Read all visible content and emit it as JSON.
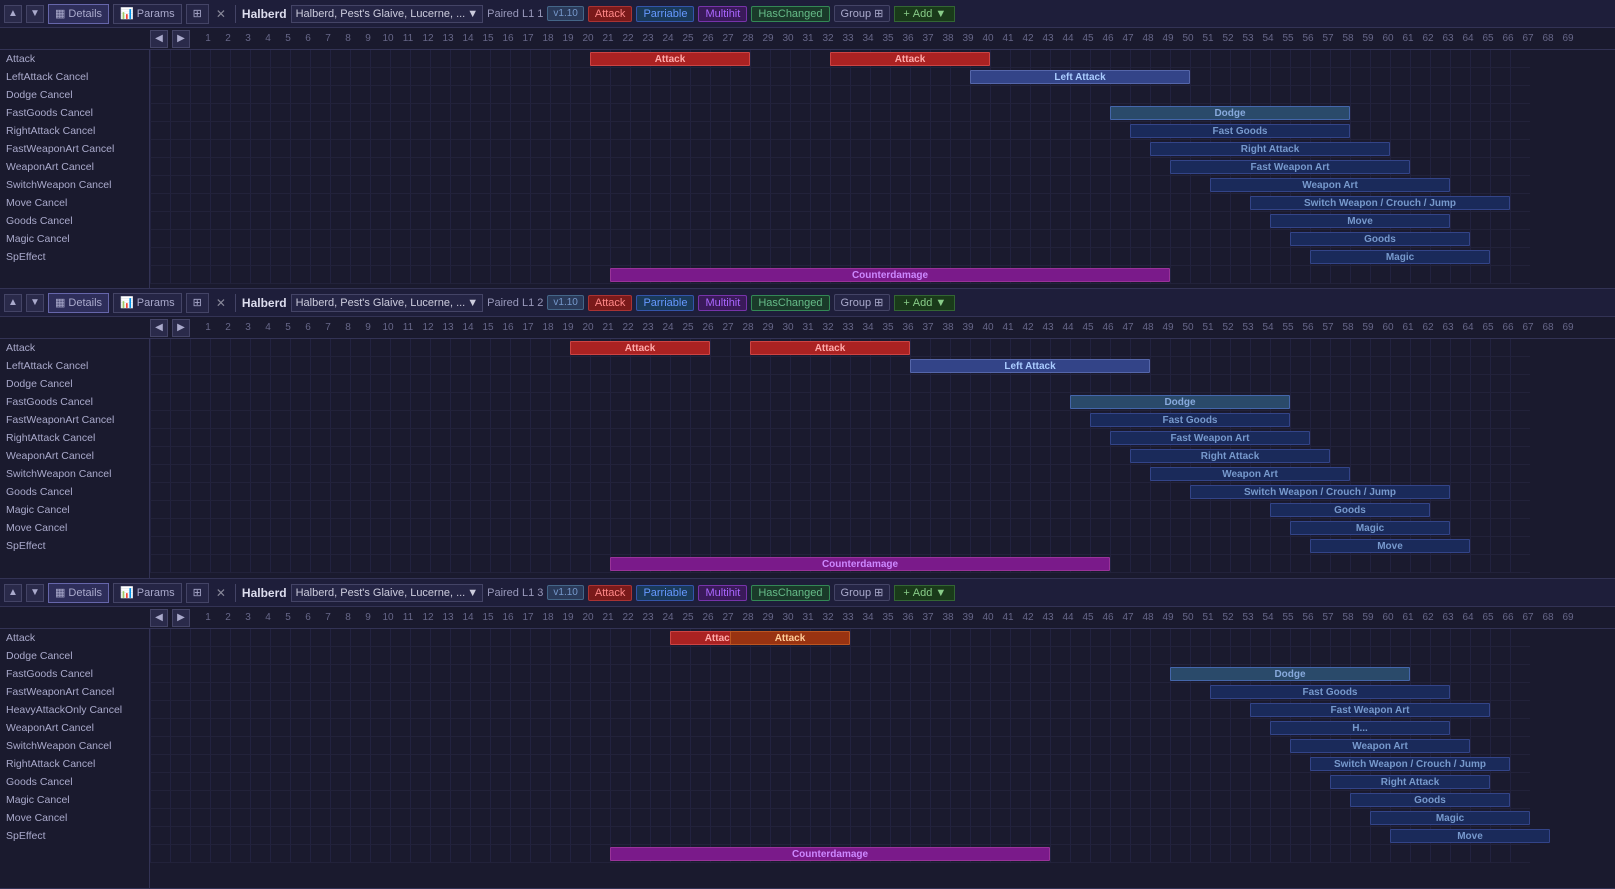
{
  "panels": [
    {
      "id": "panel1",
      "header": {
        "weapon": "Halberd",
        "dropdown": "Halberd, Pest's Glaive, Lucerne, ...",
        "combo": "Paired L1 1",
        "version": "v1.10",
        "badges": [
          "Attack",
          "Parriable",
          "Multihit",
          "HasChanged"
        ],
        "group": "Group",
        "add": "+ Add"
      },
      "rows": [
        {
          "label": "Attack",
          "bars": [
            {
              "start": 23,
              "end": 30,
              "type": "attack-red",
              "text": "Attack"
            },
            {
              "start": 35,
              "end": 42,
              "type": "attack-red",
              "text": "Attack"
            }
          ]
        },
        {
          "label": "LeftAttack Cancel",
          "bars": [
            {
              "start": 42,
              "end": 52,
              "type": "leftattack",
              "text": "Left Attack"
            }
          ]
        },
        {
          "label": "Dodge Cancel",
          "bars": []
        },
        {
          "label": "FastGoods Cancel",
          "bars": [
            {
              "start": 49,
              "end": 60,
              "type": "dodge",
              "text": "Dodge"
            }
          ]
        },
        {
          "label": "RightAttack Cancel",
          "bars": [
            {
              "start": 50,
              "end": 60,
              "type": "blue-dark",
              "text": "Fast Goods"
            }
          ]
        },
        {
          "label": "FastWeaponArt Cancel",
          "bars": [
            {
              "start": 51,
              "end": 62,
              "type": "blue-dark",
              "text": "Right Attack"
            }
          ]
        },
        {
          "label": "WeaponArt Cancel",
          "bars": [
            {
              "start": 52,
              "end": 63,
              "type": "blue-dark",
              "text": "Fast Weapon Art"
            }
          ]
        },
        {
          "label": "SwitchWeapon Cancel",
          "bars": [
            {
              "start": 54,
              "end": 65,
              "type": "blue-dark",
              "text": "Weapon Art"
            }
          ]
        },
        {
          "label": "Move Cancel",
          "bars": [
            {
              "start": 56,
              "end": 68,
              "type": "blue-dark",
              "text": "Switch Weapon / Crouch / Jump"
            }
          ]
        },
        {
          "label": "Goods Cancel",
          "bars": [
            {
              "start": 57,
              "end": 65,
              "type": "blue-dark",
              "text": "Move"
            }
          ]
        },
        {
          "label": "Magic Cancel",
          "bars": [
            {
              "start": 58,
              "end": 66,
              "type": "blue-dark",
              "text": "Goods"
            }
          ]
        },
        {
          "label": "SpEffect",
          "bars": [
            {
              "start": 59,
              "end": 67,
              "type": "blue-dark",
              "text": "Magic"
            }
          ]
        },
        {
          "label": "",
          "bars": [
            {
              "start": 24,
              "end": 51,
              "type": "counterdamage",
              "text": "Counterdamage"
            }
          ]
        }
      ]
    },
    {
      "id": "panel2",
      "header": {
        "weapon": "Halberd",
        "dropdown": "Halberd, Pest's Glaive, Lucerne, ...",
        "combo": "Paired L1 2",
        "version": "v1.10",
        "badges": [
          "Attack",
          "Parriable",
          "Multihit",
          "HasChanged"
        ],
        "group": "Group",
        "add": "+ Add"
      },
      "rows": [
        {
          "label": "Attack",
          "bars": [
            {
              "start": 22,
              "end": 28,
              "type": "attack-red",
              "text": "Attack"
            },
            {
              "start": 31,
              "end": 38,
              "type": "attack-red",
              "text": "Attack"
            }
          ]
        },
        {
          "label": "LeftAttack Cancel",
          "bars": [
            {
              "start": 39,
              "end": 50,
              "type": "leftattack",
              "text": "Left Attack"
            }
          ]
        },
        {
          "label": "Dodge Cancel",
          "bars": []
        },
        {
          "label": "FastGoods Cancel",
          "bars": [
            {
              "start": 47,
              "end": 57,
              "type": "dodge",
              "text": "Dodge"
            }
          ]
        },
        {
          "label": "FastWeaponArt Cancel",
          "bars": [
            {
              "start": 48,
              "end": 57,
              "type": "blue-dark",
              "text": "Fast Goods"
            }
          ]
        },
        {
          "label": "RightAttack Cancel",
          "bars": [
            {
              "start": 49,
              "end": 58,
              "type": "blue-dark",
              "text": "Fast Weapon Art"
            }
          ]
        },
        {
          "label": "WeaponArt Cancel",
          "bars": [
            {
              "start": 50,
              "end": 59,
              "type": "blue-dark",
              "text": "Right Attack"
            }
          ]
        },
        {
          "label": "SwitchWeapon Cancel",
          "bars": [
            {
              "start": 51,
              "end": 60,
              "type": "blue-dark",
              "text": "Weapon Art"
            }
          ]
        },
        {
          "label": "Goods Cancel",
          "bars": [
            {
              "start": 53,
              "end": 65,
              "type": "blue-dark",
              "text": "Switch Weapon / Crouch / Jump"
            }
          ]
        },
        {
          "label": "Magic Cancel",
          "bars": [
            {
              "start": 57,
              "end": 64,
              "type": "blue-dark",
              "text": "Goods"
            }
          ]
        },
        {
          "label": "Move Cancel",
          "bars": [
            {
              "start": 58,
              "end": 65,
              "type": "blue-dark",
              "text": "Magic"
            }
          ]
        },
        {
          "label": "SpEffect",
          "bars": [
            {
              "start": 59,
              "end": 66,
              "type": "blue-dark",
              "text": "Move"
            }
          ]
        },
        {
          "label": "",
          "bars": [
            {
              "start": 24,
              "end": 48,
              "type": "counterdamage",
              "text": "Counterdamage"
            }
          ]
        }
      ]
    },
    {
      "id": "panel3",
      "header": {
        "weapon": "Halberd",
        "dropdown": "Halberd, Pest's Glaive, Lucerne, ...",
        "combo": "Paired L1 3",
        "version": "v1.10",
        "badges": [
          "Attack",
          "Parriable",
          "Multihit",
          "HasChanged"
        ],
        "group": "Group",
        "add": "+ Add"
      },
      "rows": [
        {
          "label": "Attack",
          "bars": [
            {
              "start": 27,
              "end": 31,
              "type": "attack-red",
              "text": "Attack"
            },
            {
              "start": 30,
              "end": 35,
              "type": "attack-orange",
              "text": "Attack"
            }
          ]
        },
        {
          "label": "Dodge Cancel",
          "bars": []
        },
        {
          "label": "FastGoods Cancel",
          "bars": [
            {
              "start": 52,
              "end": 63,
              "type": "dodge",
              "text": "Dodge"
            }
          ]
        },
        {
          "label": "FastWeaponArt Cancel",
          "bars": [
            {
              "start": 54,
              "end": 65,
              "type": "blue-dark",
              "text": "Fast Goods"
            }
          ]
        },
        {
          "label": "HeavyAttackOnly Cancel",
          "bars": [
            {
              "start": 56,
              "end": 67,
              "type": "blue-dark",
              "text": "Fast Weapon Art"
            }
          ]
        },
        {
          "label": "WeaponArt Cancel",
          "bars": [
            {
              "start": 57,
              "end": 65,
              "type": "blue-dark",
              "text": "H..."
            }
          ]
        },
        {
          "label": "SwitchWeapon Cancel",
          "bars": [
            {
              "start": 58,
              "end": 66,
              "type": "blue-dark",
              "text": "Weapon Art"
            }
          ]
        },
        {
          "label": "RightAttack Cancel",
          "bars": [
            {
              "start": 59,
              "end": 68,
              "type": "blue-dark",
              "text": "Switch Weapon / Crouch / Jump"
            }
          ]
        },
        {
          "label": "Goods Cancel",
          "bars": [
            {
              "start": 60,
              "end": 67,
              "type": "blue-dark",
              "text": "Right Attack"
            }
          ]
        },
        {
          "label": "Magic Cancel",
          "bars": [
            {
              "start": 61,
              "end": 68,
              "type": "blue-dark",
              "text": "Goods"
            }
          ]
        },
        {
          "label": "Move Cancel",
          "bars": [
            {
              "start": 62,
              "end": 69,
              "type": "blue-dark",
              "text": "Magic"
            }
          ]
        },
        {
          "label": "SpEffect",
          "bars": [
            {
              "start": 63,
              "end": 70,
              "type": "blue-dark",
              "text": "Move"
            }
          ]
        },
        {
          "label": "",
          "bars": [
            {
              "start": 24,
              "end": 45,
              "type": "counterdamage",
              "text": "Counterdamage"
            }
          ]
        }
      ]
    }
  ],
  "frameNumbers": [
    1,
    2,
    3,
    4,
    5,
    6,
    7,
    8,
    9,
    10,
    11,
    12,
    13,
    14,
    15,
    16,
    17,
    18,
    19,
    20,
    21,
    22,
    23,
    24,
    25,
    26,
    27,
    28,
    29,
    30,
    31,
    32,
    33,
    34,
    35,
    36,
    37,
    38,
    39,
    40,
    41,
    42,
    43,
    44,
    45,
    46,
    47,
    48,
    49,
    50,
    51,
    52,
    53,
    54,
    55,
    56,
    57,
    58,
    59,
    60,
    61,
    62,
    63,
    64,
    65,
    66,
    67,
    68,
    69
  ],
  "ui": {
    "details_label": "Details",
    "params_label": "Params",
    "up_arrow": "▲",
    "down_arrow": "▼",
    "expand_icon": "⊞",
    "close_icon": "✕",
    "chevron_down": "▼",
    "group_icon": "⊞",
    "plus_icon": "+"
  }
}
